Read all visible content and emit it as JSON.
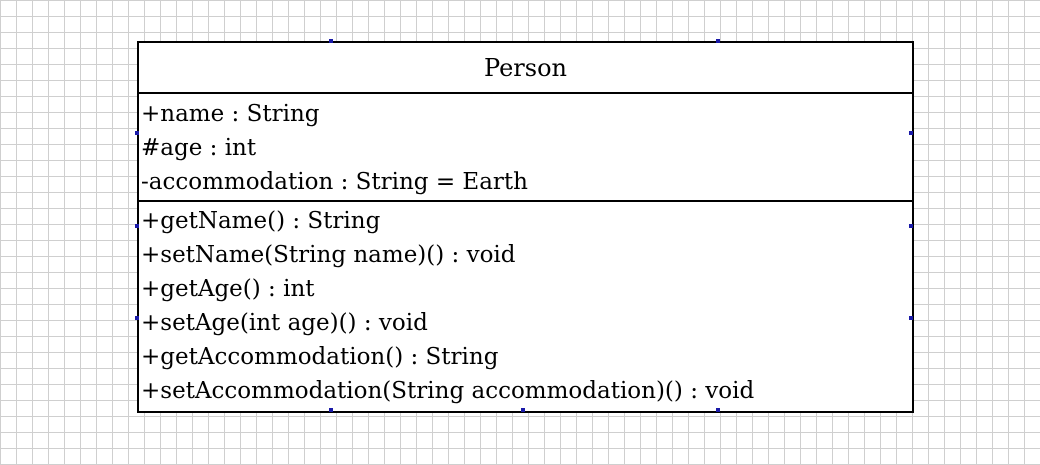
{
  "class": {
    "name": "Person",
    "attributes": [
      "+name : String",
      "#age : int",
      "-accommodation : String = Earth"
    ],
    "operations": [
      "+getName() : String",
      "+setName(String name)() : void",
      "+getAge() : int",
      "+setAge(int age)() : void",
      "+getAccommodation() : String",
      "+setAccommodation(String accommodation)() : void"
    ]
  },
  "colors": {
    "grid": "#cfcfcf",
    "border": "#000000",
    "selection_handle": "#1a1aa8"
  }
}
